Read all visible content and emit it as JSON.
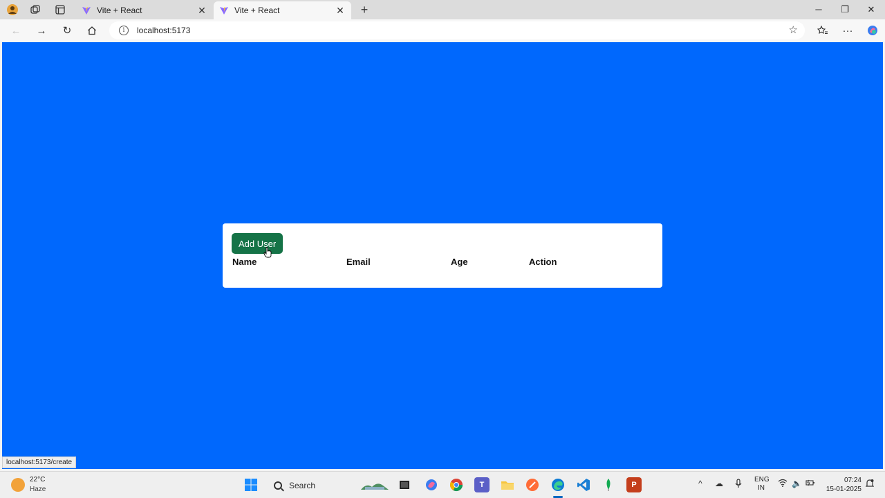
{
  "browser": {
    "tabs": [
      {
        "title": "Vite + React",
        "active": false
      },
      {
        "title": "Vite + React",
        "active": true
      }
    ],
    "new_tab": "+",
    "url": "localhost:5173",
    "status_url": "localhost:5173/create"
  },
  "page": {
    "background": "#0068fd",
    "add_button_label": "Add User",
    "add_button_color": "#157347",
    "table_headers": [
      "Name",
      "Email",
      "Age",
      "Action"
    ]
  },
  "taskbar": {
    "weather_temp": "22°C",
    "weather_desc": "Haze",
    "search_label": "Search",
    "lang_line1": "ENG",
    "lang_line2": "IN",
    "time": "07:24",
    "date": "15-01-2025"
  },
  "icons": [
    "browser-profile-icon",
    "workspaces-icon",
    "tab-actions-icon",
    "vite-favicon",
    "back-icon",
    "forward-icon",
    "refresh-icon",
    "home-icon",
    "info-icon",
    "favorite-star-icon",
    "favorites-icon",
    "more-icon",
    "copilot-icon",
    "windows-start-icon",
    "search-icon",
    "wifi-icon",
    "volume-icon",
    "battery-icon",
    "chevron-up-icon",
    "cloud-icon",
    "mic-icon"
  ]
}
